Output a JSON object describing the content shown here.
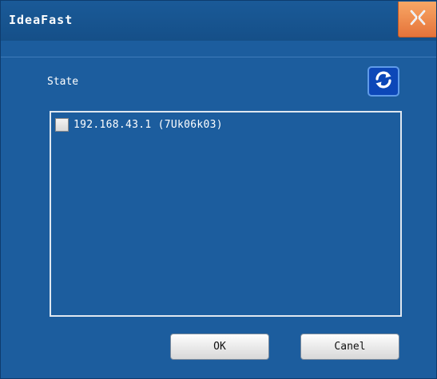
{
  "window": {
    "title": "IdeaFast",
    "close_icon": "close-icon",
    "colors": {
      "background": "#1c5d9e",
      "close_button": "#e5733a"
    }
  },
  "main": {
    "state_label": "State",
    "refresh_icon": "refresh-icon",
    "devices": [
      {
        "label": "192.168.43.1 (7Uk06k03)",
        "checked": false
      }
    ]
  },
  "footer": {
    "ok_label": "OK",
    "cancel_label": "Canel"
  }
}
